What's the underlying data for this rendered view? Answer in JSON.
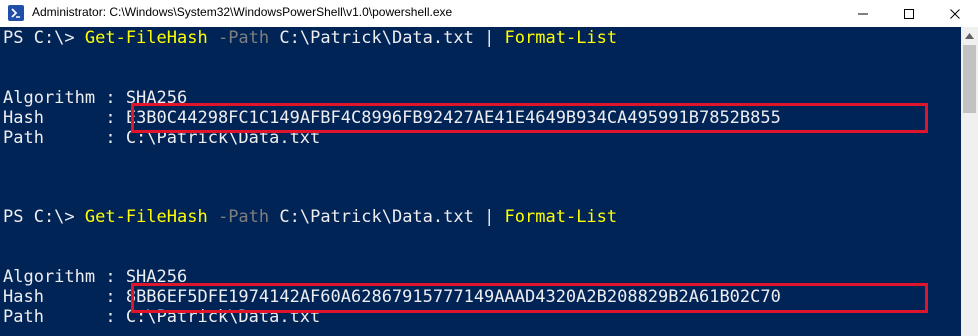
{
  "window": {
    "title": "Administrator: C:\\Windows\\System32\\WindowsPowerShell\\v1.0\\powershell.exe",
    "icon": "powershell-icon",
    "controls": [
      "minimize-icon",
      "maximize-icon",
      "close-icon"
    ]
  },
  "colors": {
    "console_bg": "#012456",
    "text": "#eeedf0",
    "command": "#ffff00",
    "parameter": "#7f7f7f",
    "highlight_border": "#e0142b"
  },
  "blocks": [
    {
      "prompt": "PS C:\\> ",
      "command": "Get-FileHash",
      "parameter": " -Path",
      "argument": " C:\\Patrick\\Data.txt | ",
      "pipe_command": "Format-List",
      "algorithm_line": "Algorithm : SHA256",
      "hash_label": "Hash      : ",
      "hash_value": "E3B0C44298FC1C149AFBF4C8996FB92427AE41E4649B934CA495991B7852B855",
      "path_line": "Path      : C:\\Patrick\\Data.txt"
    },
    {
      "prompt": "PS C:\\> ",
      "command": "Get-FileHash",
      "parameter": " -Path",
      "argument": " C:\\Patrick\\Data.txt | ",
      "pipe_command": "Format-List",
      "algorithm_line": "Algorithm : SHA256",
      "hash_label": "Hash      : ",
      "hash_value": "8BB6EF5DFE1974142AF60A62867915777149AAAD4320A2B208829B2A61B02C70",
      "path_line": "Path      : C:\\Patrick\\Data.txt"
    }
  ]
}
